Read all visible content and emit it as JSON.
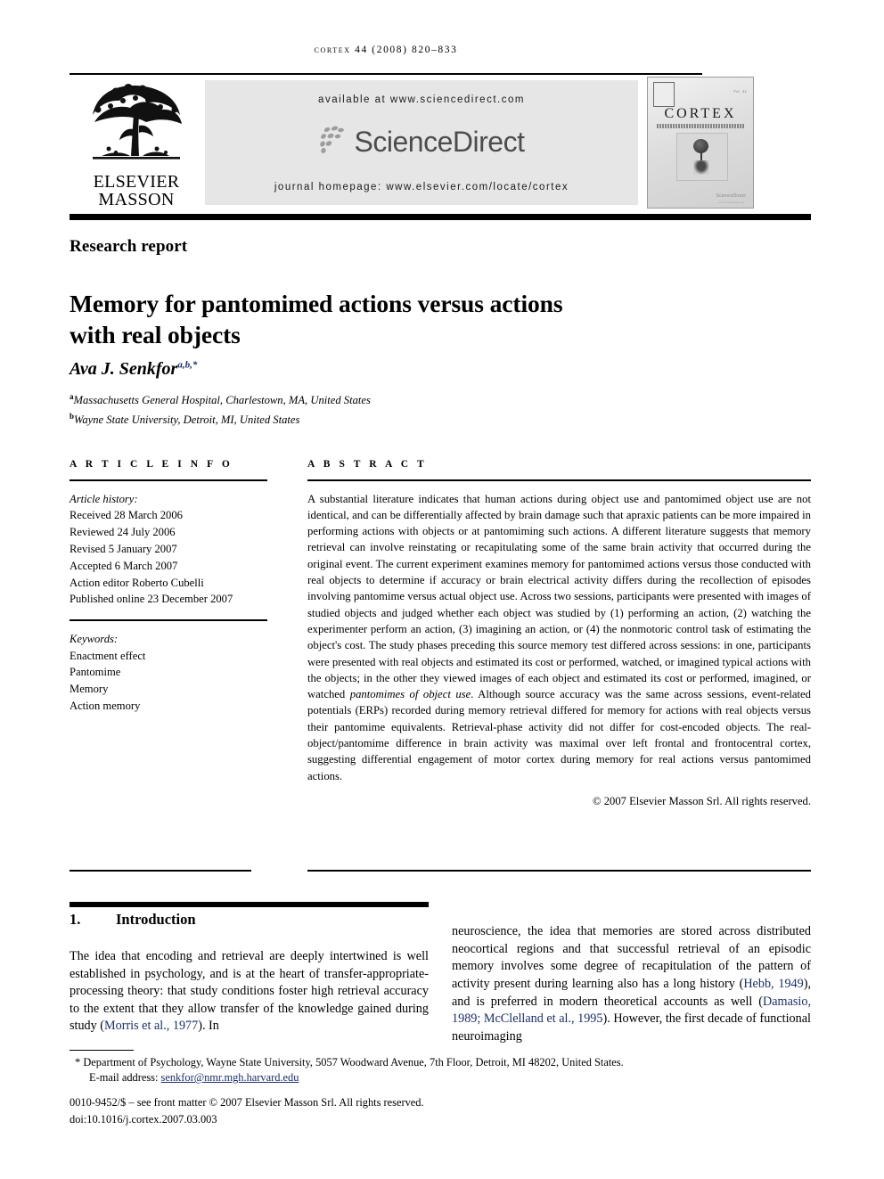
{
  "running_head": "cortex 44 (2008) 820–833",
  "header": {
    "publisher_logo": {
      "line1": "ELSEVIER",
      "line2": "MASSON",
      "icon": "elsevier-tree-logo"
    },
    "banner": {
      "available_at": "available at www.sciencedirect.com",
      "logo_text": "ScienceDirect",
      "journal_homepage": "journal homepage: www.elsevier.com/locate/cortex"
    },
    "cover": {
      "journal_name": "CORTEX",
      "tagline": "A Journal Devoted to the Study of the Nervous System and Behaviour",
      "issue_label": "Vol. 44",
      "sciencedirect_badge": "ScienceDirect",
      "sciencedirect_badge_sub": "www.sciencedirect.com"
    }
  },
  "article_type": "Research report",
  "title": "Memory for pantomimed actions versus actions with real objects",
  "author": {
    "name": "Ava J. Senkfor",
    "superscripts": "a,b,*"
  },
  "affiliations": [
    {
      "marker": "a",
      "text": "Massachusetts General Hospital, Charlestown, MA, United States"
    },
    {
      "marker": "b",
      "text": "Wayne State University, Detroit, MI, United States"
    }
  ],
  "article_info": {
    "heading": "A R T I C L E   I N F O",
    "history_label": "Article history:",
    "history": [
      "Received 28 March 2006",
      "Reviewed 24 July 2006",
      "Revised 5 January 2007",
      "Accepted 6 March 2007",
      "Action editor Roberto Cubelli",
      "Published online 23 December 2007"
    ],
    "keywords_label": "Keywords:",
    "keywords": [
      "Enactment effect",
      "Pantomime",
      "Memory",
      "Action memory"
    ]
  },
  "abstract": {
    "heading": "A B S T R A C T",
    "part1": "A substantial literature indicates that human actions during object use and pantomimed object use are not identical, and can be differentially affected by brain damage such that apraxic patients can be more impaired in performing actions with objects or at pantomiming such actions. A different literature suggests that memory retrieval can involve reinstating or recapitulating some of the same brain activity that occurred during the original event. The current experiment examines memory for pantomimed actions versus those conducted with real objects to determine if accuracy or brain electrical activity differs during the recollection of episodes involving pantomime versus actual object use. Across two sessions, participants were presented with images of studied objects and judged whether each object was studied by (1) performing an action, (2) watching the experimenter perform an action, (3) imagining an action, or (4) the nonmotoric control task of estimating the object's cost. The study phases preceding this source memory test differed across sessions: in one, participants were presented with real objects and estimated its cost or performed, watched, or imagined typical actions with the objects; in the other they viewed images of each object and estimated its cost or performed, imagined, or watched ",
    "italic1": "pantomimes of object use",
    "part2": ". Although source accuracy was the same across sessions, event-related potentials (ERPs) recorded during memory retrieval differed for memory for actions with real objects versus their pantomime equivalents. Retrieval-phase activity did not differ for cost-encoded objects. The real-object/pantomime difference in brain activity was maximal over left frontal and frontocentral cortex, suggesting differential engagement of motor cortex during memory for real actions versus pantomimed actions.",
    "copyright": "© 2007 Elsevier Masson Srl. All rights reserved."
  },
  "introduction": {
    "number": "1.",
    "heading": "Introduction",
    "left_part1": "The idea that encoding and retrieval are deeply intertwined is well established in psychology, and is at the heart of transfer-appropriate-processing theory: that study conditions foster high retrieval accuracy to the extent that they allow transfer of the knowledge gained during study (",
    "left_ref1": "Morris et al., 1977",
    "left_part2": "). In",
    "right_part1": "neuroscience, the idea that memories are stored across distributed neocortical regions and that successful retrieval of an episodic memory involves some degree of recapitulation of the pattern of activity present during learning also has a long history (",
    "right_ref1": "Hebb, 1949",
    "right_part2": "), and is preferred in modern theoretical accounts as well (",
    "right_ref2": "Damasio, 1989; McClelland et al., 1995",
    "right_part3": "). However, the first decade of functional neuroimaging"
  },
  "footer": {
    "corresponding_marker": "*",
    "corresponding_address": "Department of Psychology, Wayne State University, 5057 Woodward Avenue, 7th Floor, Detroit, MI 48202, United States.",
    "email_label": "E-mail address:",
    "email": "senkfor@nmr.mgh.harvard.edu",
    "imprint": "0010-9452/$ – see front matter © 2007 Elsevier Masson Srl. All rights reserved.",
    "doi": "doi:10.1016/j.cortex.2007.03.003"
  },
  "colors": {
    "link": "#1a2f6b",
    "banner_bg": "#e6e6e6",
    "sd_gray": "#4d4d4d"
  }
}
